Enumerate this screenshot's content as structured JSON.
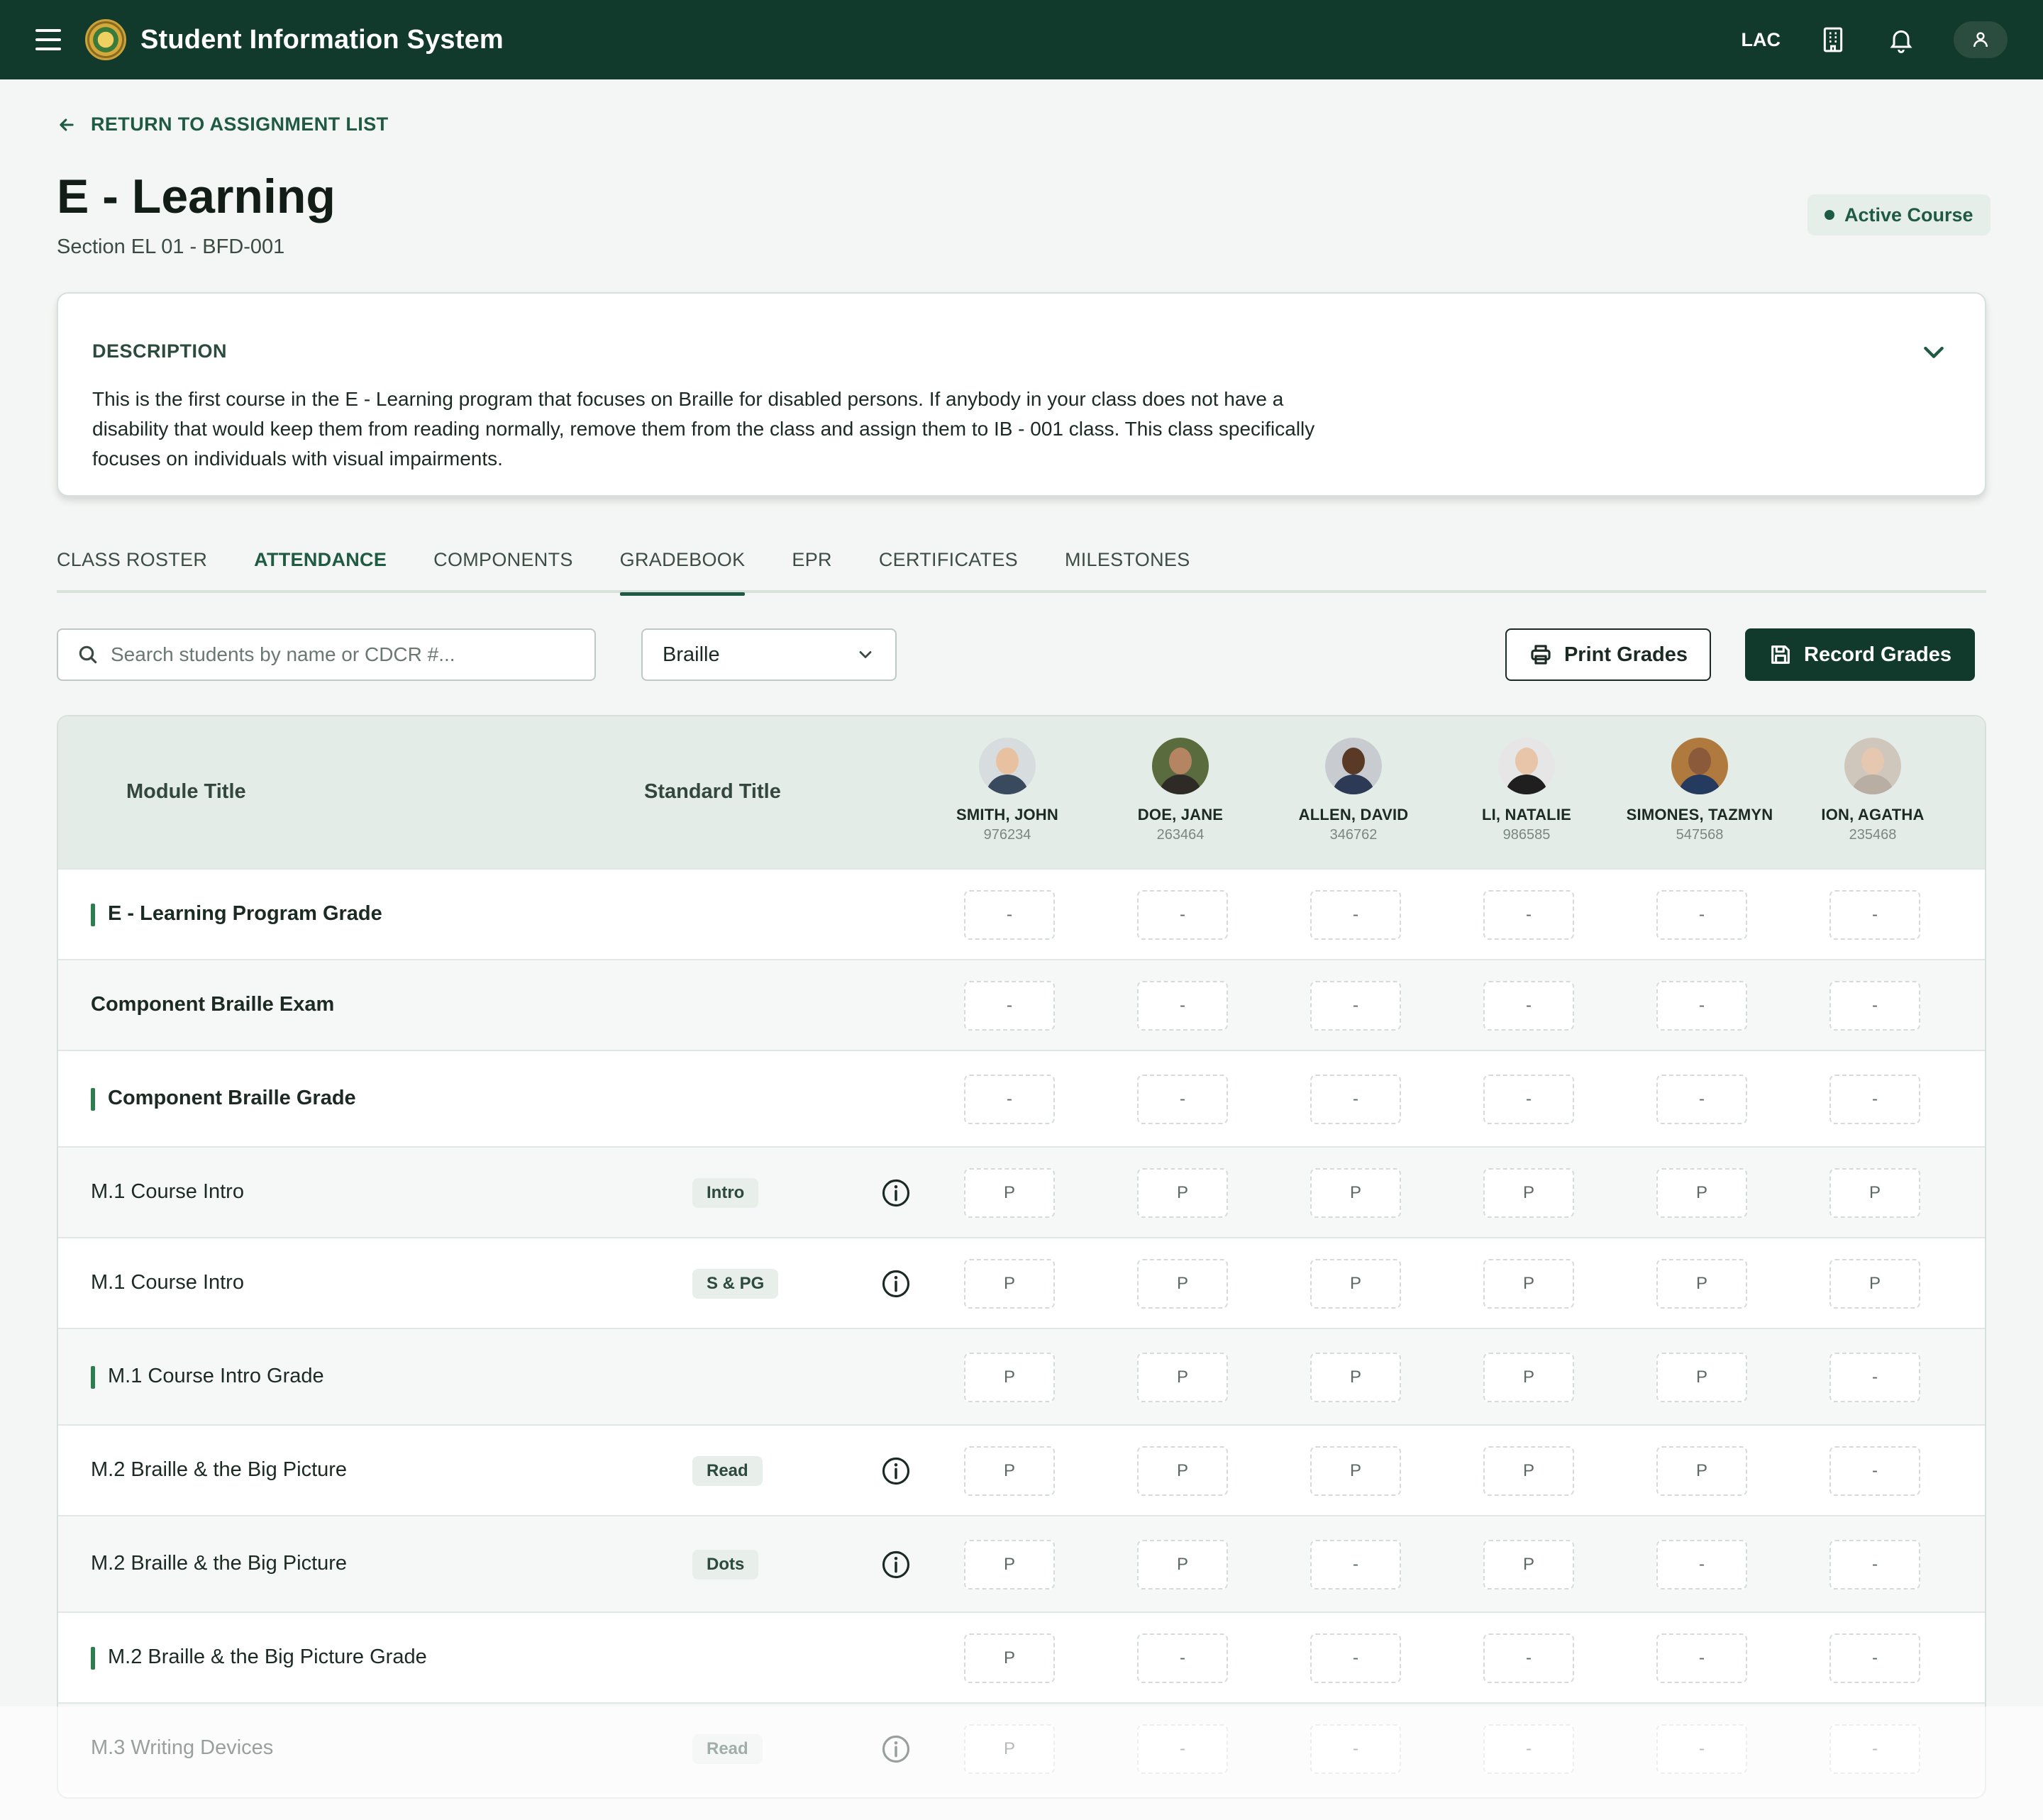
{
  "app": {
    "title": "Student Information System",
    "lac": "LAC"
  },
  "back_link": "RETURN TO ASSIGNMENT LIST",
  "course": {
    "title": "E - Learning",
    "section": "Section EL 01 - BFD-001",
    "status": "Active Course"
  },
  "description": {
    "label": "DESCRIPTION",
    "text": "This is the first course in the E - Learning program that focuses on Braille for disabled persons. If anybody in your class does not have a disability that would keep them from reading normally, remove them from the class and assign them to IB - 001 class. This class specifically focuses on individuals with visual impairments."
  },
  "tabs": [
    {
      "label": "CLASS ROSTER"
    },
    {
      "label": "ATTENDANCE"
    },
    {
      "label": "COMPONENTS"
    },
    {
      "label": "GRADEBOOK"
    },
    {
      "label": "EPR"
    },
    {
      "label": "CERTIFICATES"
    },
    {
      "label": "MILESTONES"
    }
  ],
  "toolbar": {
    "search_placeholder": "Search students by name or CDCR #...",
    "filter_value": "Braille",
    "print_label": "Print Grades",
    "record_label": "Record Grades"
  },
  "table": {
    "headers": {
      "module": "Module Title",
      "standard": "Standard Title"
    },
    "students": [
      {
        "name": "SMITH, JOHN",
        "id": "976234"
      },
      {
        "name": "DOE, JANE",
        "id": "263464"
      },
      {
        "name": "ALLEN, DAVID",
        "id": "346762"
      },
      {
        "name": "LI, NATALIE",
        "id": "986585"
      },
      {
        "name": "SIMONES, TAZMYN",
        "id": "547568"
      },
      {
        "name": "ION, AGATHA",
        "id": "235468"
      }
    ],
    "rows": [
      {
        "title": "E - Learning Program Grade",
        "tag": "",
        "grades": [
          "-",
          "-",
          "-",
          "-",
          "-",
          "-"
        ]
      },
      {
        "title": "Component Braille Exam",
        "tag": "",
        "grades": [
          "-",
          "-",
          "-",
          "-",
          "-",
          "-"
        ]
      },
      {
        "title": "Component Braille Grade",
        "tag": "",
        "grades": [
          "-",
          "-",
          "-",
          "-",
          "-",
          "-"
        ]
      },
      {
        "title": "M.1 Course Intro",
        "tag": "Intro",
        "grades": [
          "P",
          "P",
          "P",
          "P",
          "P",
          "P"
        ]
      },
      {
        "title": "M.1 Course Intro",
        "tag": "S & PG",
        "grades": [
          "P",
          "P",
          "P",
          "P",
          "P",
          "P"
        ]
      },
      {
        "title": "M.1 Course Intro Grade",
        "tag": "",
        "grades": [
          "P",
          "P",
          "P",
          "P",
          "P",
          "-"
        ]
      },
      {
        "title": "M.2 Braille & the Big Picture",
        "tag": "Read",
        "grades": [
          "P",
          "P",
          "P",
          "P",
          "P",
          "-"
        ]
      },
      {
        "title": "M.2 Braille & the Big Picture",
        "tag": "Dots",
        "grades": [
          "P",
          "P",
          "-",
          "P",
          "-",
          "-"
        ]
      },
      {
        "title": "M.2 Braille & the Big Picture Grade",
        "tag": "",
        "grades": [
          "P",
          "-",
          "-",
          "-",
          "-",
          "-"
        ]
      },
      {
        "title": "M.3 Writing Devices",
        "tag": "Read",
        "grades": [
          "P",
          "-",
          "-",
          "-",
          "-",
          "-"
        ]
      }
    ]
  },
  "colors": {
    "brand": "#123a2c",
    "accent": "#1f5a43",
    "bar": "#2e7d4f"
  },
  "icons": [
    "menu-icon",
    "seal-logo",
    "building-icon",
    "bell-icon",
    "user-icon",
    "arrow-left-icon",
    "chevron-down-icon",
    "search-icon",
    "printer-icon",
    "save-icon",
    "info-icon"
  ]
}
